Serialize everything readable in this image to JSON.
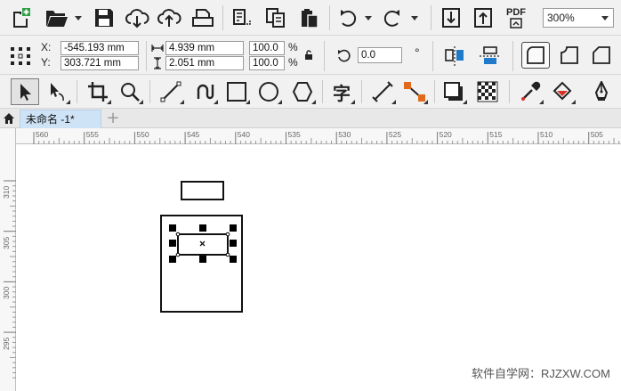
{
  "toolbar_standard": {
    "icons": [
      "new-document-icon",
      "open-folder-icon",
      "save-icon",
      "import-cloud-icon",
      "export-cloud-icon",
      "print-icon",
      "cut-icon",
      "copy-icon",
      "paste-icon",
      "undo-icon",
      "redo-icon",
      "import-icon",
      "export-icon",
      "publish-pdf-icon"
    ],
    "pdf_label": "PDF",
    "zoom_value": "300%"
  },
  "property_bar": {
    "x_label": "X:",
    "y_label": "Y:",
    "x_value": "-545.193 mm",
    "y_value": "303.721 mm",
    "width_value": "4.939 mm",
    "height_value": "2.051 mm",
    "scale_x": "100.0",
    "scale_y": "100.0",
    "percent_symbol": "%",
    "rotation_value": "0.0",
    "degree_symbol": "°"
  },
  "toolbox": {
    "tools": [
      "pick-tool",
      "shape-tool",
      "crop-tool",
      "zoom-tool",
      "freehand-tool",
      "artistic-media-tool",
      "rectangle-tool",
      "ellipse-tool",
      "polygon-tool",
      "text-tool",
      "dimension-tool",
      "connector-tool",
      "drop-shadow-tool",
      "transparency-tool",
      "eyedropper-tool",
      "interactive-fill-tool",
      "smart-fill-tool"
    ],
    "text_tool_glyph": "字"
  },
  "tabs": {
    "document_tab": "未命名 -1*",
    "add_tab": "+"
  },
  "rulers": {
    "horizontal_ticks": [
      "560",
      "555",
      "550",
      "545",
      "540",
      "535",
      "530",
      "525",
      "520",
      "515",
      "510",
      "505"
    ],
    "vertical_ticks": [
      "310",
      "305",
      "300",
      "295"
    ]
  },
  "watermark": "软件自学网：RJZXW.COM",
  "colors": {
    "toolbar_bg": "#f1f1f1",
    "tab_active": "#cfe3f7",
    "accent_blue": "#1f7ac9",
    "accent_red": "#d93025",
    "accent_green": "#2f9e44",
    "accent_orange": "#e06a1b"
  }
}
